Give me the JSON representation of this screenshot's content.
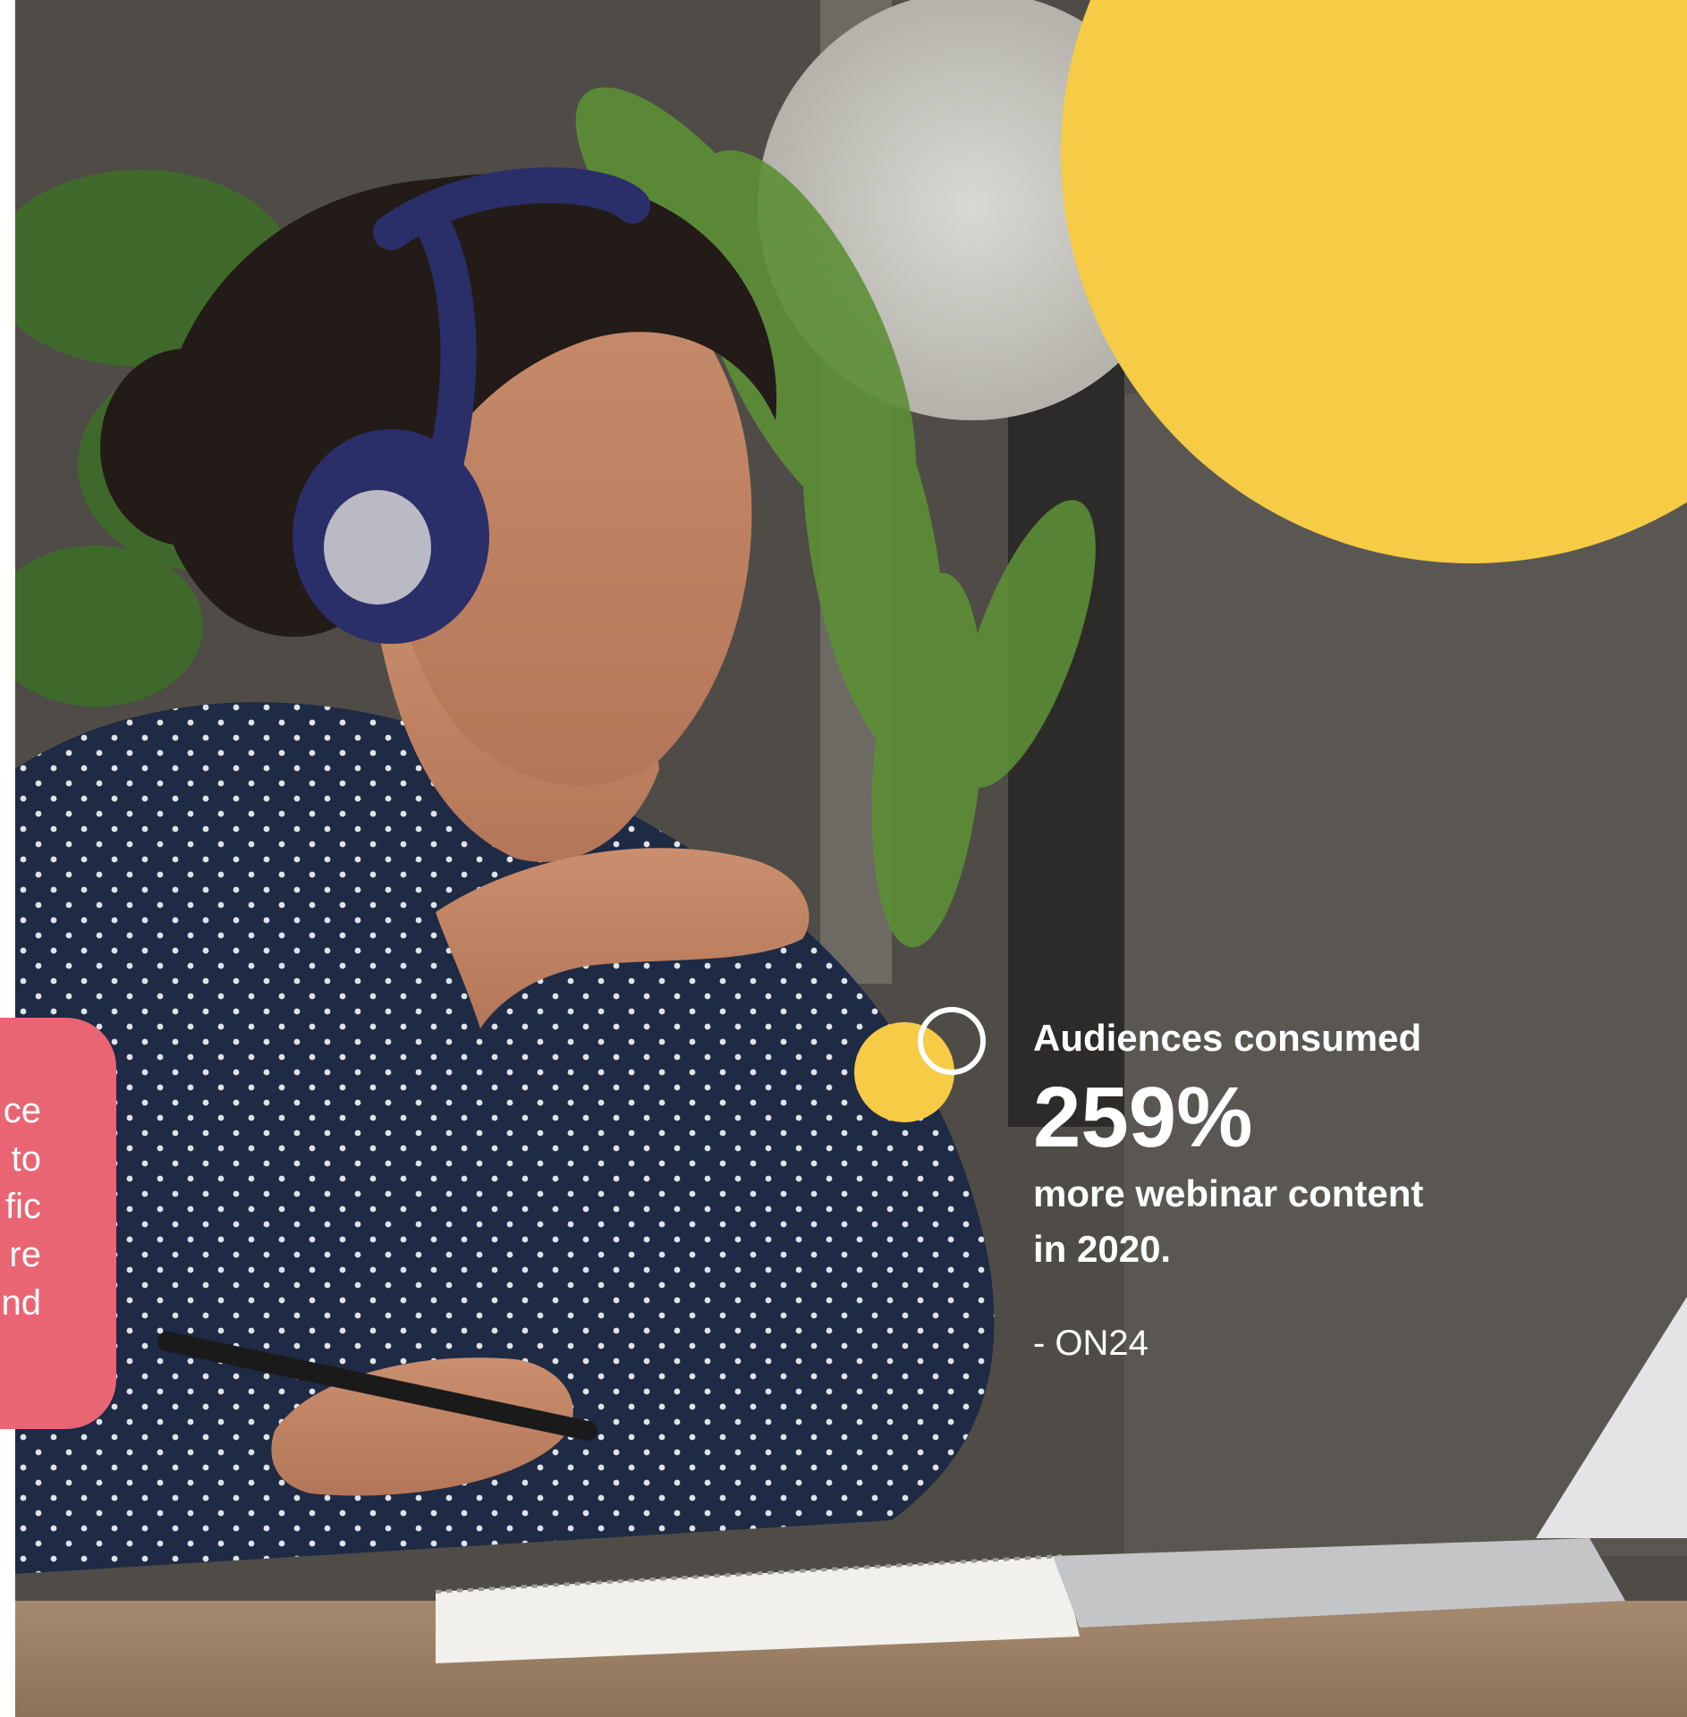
{
  "stat": {
    "lead": "Audiences consumed",
    "figure": "259%",
    "trail_line1": "more webinar content",
    "trail_line2": "in 2020.",
    "source": "- ON24"
  },
  "side_card": {
    "lines": [
      "ce",
      "to",
      "fic",
      "re",
      "nd"
    ]
  },
  "colors": {
    "accent_yellow": "#F6CB45",
    "accent_pink": "#E96574",
    "text_white": "#FFFFFF",
    "shirt_navy": "#1F2A44"
  },
  "icons": [
    "filled-circle-icon",
    "ring-icon"
  ]
}
